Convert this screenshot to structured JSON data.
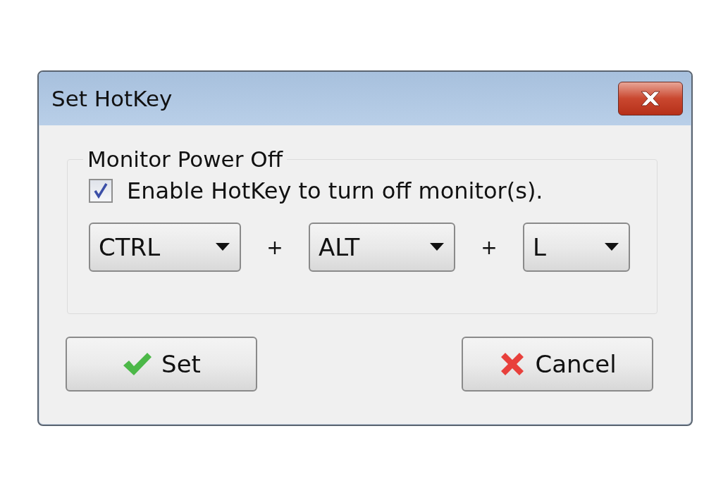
{
  "window": {
    "title": "Set HotKey"
  },
  "group": {
    "title": "Monitor Power Off"
  },
  "checkbox": {
    "label": "Enable HotKey to turn off monitor(s).",
    "checked": true
  },
  "combos": [
    {
      "value": "CTRL"
    },
    {
      "value": "ALT"
    },
    {
      "value": "L"
    }
  ],
  "separators": [
    "+",
    "+"
  ],
  "buttons": [
    {
      "label": "Set",
      "kind": "confirm"
    },
    {
      "label": "Cancel",
      "kind": "cancel"
    }
  ]
}
